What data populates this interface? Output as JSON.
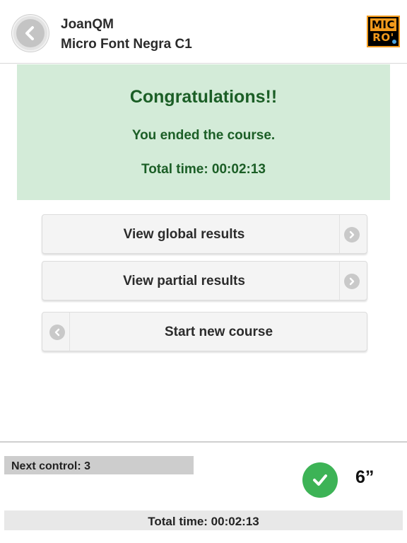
{
  "header": {
    "user": "JoanQM",
    "course": "Micro Font Negra C1",
    "back_icon": "chevron-left-icon",
    "logo": {
      "line1": "MIC",
      "line2": "RO'"
    }
  },
  "result": {
    "title": "Congratulations!!",
    "message": "You ended the course.",
    "total_time": "Total time: 00:02:13"
  },
  "actions": {
    "view_global": "View global results",
    "view_partial": "View partial results",
    "start_new": "Start new course"
  },
  "footer": {
    "next_control": "Next control: 3",
    "status_icon": "check-icon",
    "seconds": "6”",
    "total_time": "Total time: 00:02:13"
  },
  "colors": {
    "success_bg": "#d3ebd8",
    "success_text": "#1b5e26",
    "check_green": "#3db356",
    "logo_orange": "#f29a1c"
  }
}
